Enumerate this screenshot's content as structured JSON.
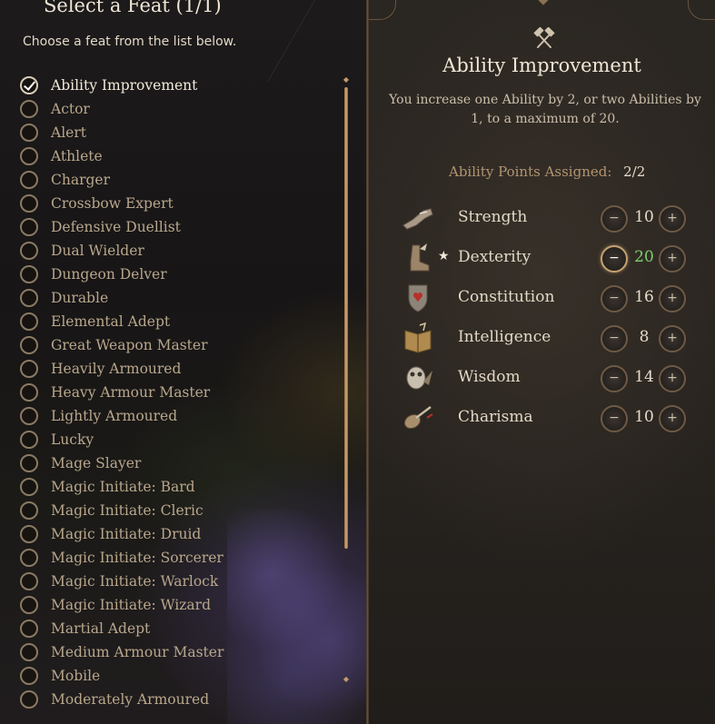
{
  "left_panel": {
    "title": "Select a Feat (1/1)",
    "subtitle": "Choose a feat from the list below.",
    "feats": [
      {
        "label": "Ability Improvement",
        "selected": true
      },
      {
        "label": "Actor"
      },
      {
        "label": "Alert"
      },
      {
        "label": "Athlete"
      },
      {
        "label": "Charger"
      },
      {
        "label": "Crossbow Expert"
      },
      {
        "label": "Defensive Duellist"
      },
      {
        "label": "Dual Wielder"
      },
      {
        "label": "Dungeon Delver"
      },
      {
        "label": "Durable"
      },
      {
        "label": "Elemental Adept"
      },
      {
        "label": "Great Weapon Master"
      },
      {
        "label": "Heavily Armoured"
      },
      {
        "label": "Heavy Armour Master"
      },
      {
        "label": "Lightly Armoured"
      },
      {
        "label": "Lucky"
      },
      {
        "label": "Mage Slayer"
      },
      {
        "label": "Magic Initiate: Bard"
      },
      {
        "label": "Magic Initiate: Cleric"
      },
      {
        "label": "Magic Initiate: Druid"
      },
      {
        "label": "Magic Initiate: Sorcerer"
      },
      {
        "label": "Magic Initiate: Warlock"
      },
      {
        "label": "Magic Initiate: Wizard"
      },
      {
        "label": "Martial Adept"
      },
      {
        "label": "Medium Armour Master"
      },
      {
        "label": "Mobile"
      },
      {
        "label": "Moderately Armoured"
      }
    ],
    "scroll_up_icon": "chevron-up-icon",
    "scroll_down_icon": "chevron-down-icon"
  },
  "detail": {
    "icon": "crossed-hammers-icon",
    "title": "Ability Improvement",
    "description": "You increase one Ability by 2, or two Abilities by 1, to a maximum of 20.",
    "points_label": "Ability Points Assigned:",
    "points_value": "2/2",
    "minus_symbol": "−",
    "plus_symbol": "+",
    "abilities": [
      {
        "name": "Strength",
        "value": "10",
        "icon": "arm-icon",
        "star": false
      },
      {
        "name": "Dexterity",
        "value": "20",
        "icon": "boot-icon",
        "star": true,
        "star_symbol": "★",
        "highlight_color": "#7fcf6c"
      },
      {
        "name": "Constitution",
        "value": "16",
        "icon": "shield-heart-icon",
        "star": false
      },
      {
        "name": "Intelligence",
        "value": "8",
        "icon": "book-icon",
        "star": false
      },
      {
        "name": "Wisdom",
        "value": "14",
        "icon": "owl-icon",
        "star": false
      },
      {
        "name": "Charisma",
        "value": "10",
        "icon": "lute-icon",
        "star": false
      }
    ]
  }
}
